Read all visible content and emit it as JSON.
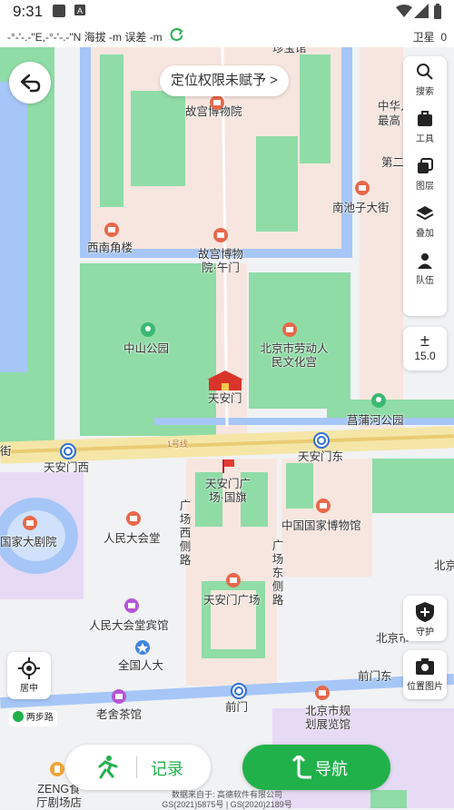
{
  "status": {
    "time": "9:31",
    "icons": [
      "photo-icon",
      "a-box-icon",
      "wifi-icon",
      "signal-icon",
      "battery-icon"
    ]
  },
  "info_bar": {
    "coords": "-°-'-.-\"E,-°-'-.-\"N 海拔 -m 误差 -m",
    "satellite_label": "卫星",
    "satellite_count": "0"
  },
  "location_permission": "定位权限未赋予 >",
  "toolbar": {
    "items": [
      {
        "icon": "search-icon",
        "label": "搜索"
      },
      {
        "icon": "toolbox-icon",
        "label": "工具"
      },
      {
        "icon": "layers-icon",
        "label": "图层"
      },
      {
        "icon": "stack-icon",
        "label": "叠加"
      },
      {
        "icon": "team-icon",
        "label": "队伍"
      }
    ],
    "zoom_symbol": "±",
    "zoom_level": "15.0",
    "guard_label": "守护",
    "position_photo_label": "位置图片",
    "center_label": "居中",
    "walk_label": "两步路"
  },
  "map_labels": {
    "top_cut": "珍宝馆",
    "gugong": "故宫博物院",
    "zhonghua": "中华人民共和",
    "zuigao": "最高",
    "dier": "第二",
    "nanchizi": "南池子大街",
    "xinan": "西南角楼",
    "wumen": "故宫博物院·午门",
    "zhongshan": "中山公园",
    "laodong": "北京市劳动人民文化宫",
    "tiananmen": "天安门",
    "changpu": "菖蒲河公园",
    "jie": "街",
    "line1": "1号线",
    "tam_west": "天安门西",
    "tam_east": "天安门东",
    "guoqi": "天安门广场·国旗",
    "guangchang_west": "广场西侧路",
    "guangchang_east": "广场东侧路",
    "national_museum": "中国国家博物馆",
    "bei": "北京",
    "grand_theater": "国家大剧院",
    "great_hall": "人民大会堂",
    "square": "天安门广场",
    "hotel": "人民大会堂宾馆",
    "npc": "全国人大",
    "qianmen_east": "前门东",
    "beijing_fang": "北京市",
    "qianmen": "前门",
    "laoshe": "老舍茶馆",
    "planning": "北京市规划展览馆",
    "zeng": "ZENG食厅剧场店"
  },
  "bottom": {
    "record_label": "记录",
    "navigate_label": "导航"
  },
  "footer": {
    "line1": "数据来自于: 高德软件有限公司",
    "line2": "GS(2021)5875号 | GS(2020)2189号"
  },
  "colors": {
    "accent": "#21b14b",
    "poi": "#e8684a",
    "water": "#a6c6f7",
    "park": "#8fdca6",
    "palace": "#f7e6df"
  }
}
